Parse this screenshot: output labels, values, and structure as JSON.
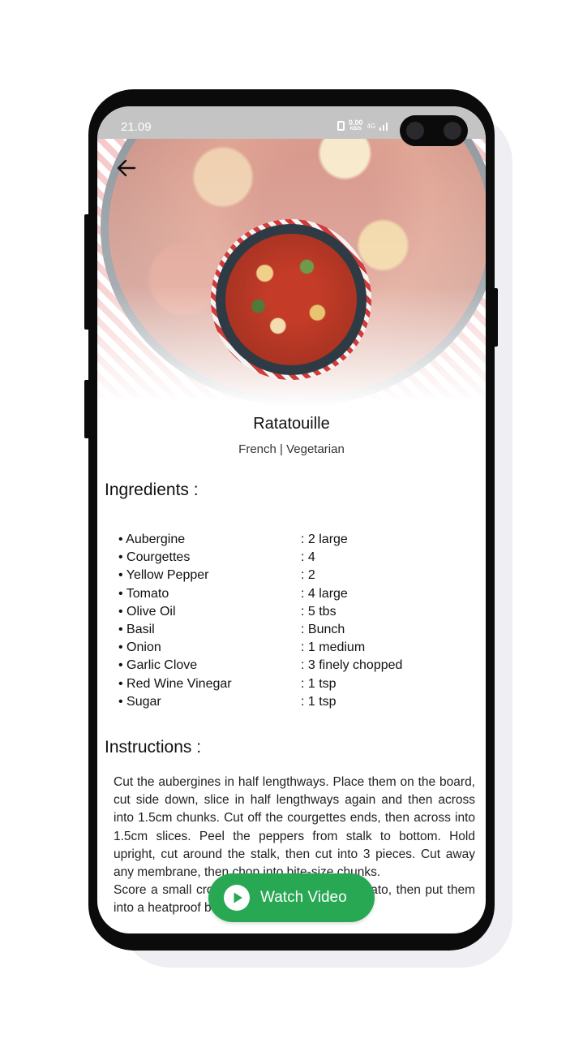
{
  "status_bar": {
    "time": "21.09",
    "speed": "0.00",
    "speed_unit": "KB/S",
    "network": "4G"
  },
  "recipe": {
    "title": "Ratatouille",
    "subtitle": "French | Vegetarian"
  },
  "ingredients": {
    "heading": "Ingredients :",
    "items": [
      {
        "name": "Aubergine",
        "qty": ": 2 large"
      },
      {
        "name": "Courgettes",
        "qty": ": 4"
      },
      {
        "name": "Yellow Pepper",
        "qty": ": 2"
      },
      {
        "name": "Tomato",
        "qty": ": 4 large"
      },
      {
        "name": "Olive Oil",
        "qty": ": 5 tbs"
      },
      {
        "name": "Basil",
        "qty": ": Bunch"
      },
      {
        "name": "Onion",
        "qty": ": 1 medium"
      },
      {
        "name": "Garlic Clove",
        "qty": ": 3 finely chopped"
      },
      {
        "name": "Red Wine Vinegar",
        "qty": ": 1 tsp"
      },
      {
        "name": "Sugar",
        "qty": ": 1 tsp"
      }
    ]
  },
  "instructions": {
    "heading": "Instructions :",
    "para1": "Cut the aubergines in half lengthways. Place them on the board, cut side down, slice in half lengthways again and then across into 1.5cm chunks. Cut off the courgettes ends, then across into 1.5cm slices. Peel the peppers from stalk to bottom. Hold upright, cut around the stalk, then cut into 3 pieces. Cut away any membrane, then chop into bite-size chunks.",
    "para2": "Score a small cross on the base of each tomato, then put them into a heatproof bowl. Pour boiling water over"
  },
  "actions": {
    "watch_video": "Watch Video"
  }
}
